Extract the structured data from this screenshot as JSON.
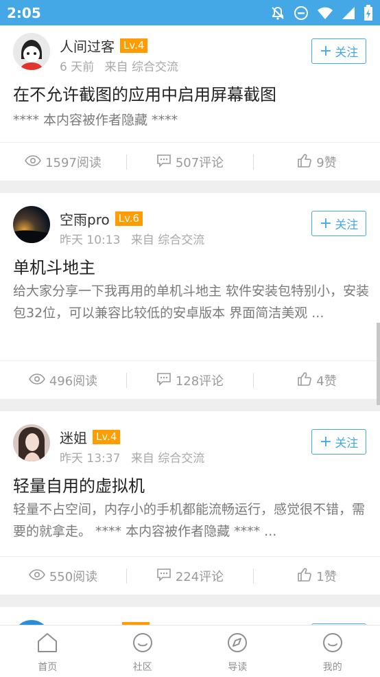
{
  "statusbar": {
    "time": "2:05",
    "icons": [
      "bell-off-icon",
      "do-not-disturb-icon",
      "wifi-icon",
      "signal-icon",
      "battery-charging-icon"
    ]
  },
  "follow_label": "关注",
  "posts": [
    {
      "author": "人间过客",
      "level": "Lv.4",
      "time": "6 天前",
      "source": "来自 综合交流",
      "title": "在不允许截图的应用中启用屏幕截图",
      "body": "**** 本内容被作者隐藏 ****",
      "reads": "1597阅读",
      "comments": "507评论",
      "likes": "9赞"
    },
    {
      "author": "空雨pro",
      "level": "Lv.6",
      "time": "昨天 10:13",
      "source": "来自 综合交流",
      "title": "单机斗地主",
      "body": "给大家分享一下我再用的单机斗地主 软件安装包特别小，安装包32位，可以兼容比较低的安卓版本 界面简洁美观 ...",
      "reads": "496阅读",
      "comments": "128评论",
      "likes": "4赞"
    },
    {
      "author": "迷姐",
      "level": "Lv.4",
      "time": "昨天 13:37",
      "source": "来自 综合交流",
      "title": "轻量自用的虚拟机",
      "body": "轻量不占空间，内存小的手机都能流畅运行，感觉很不错，需要的就拿走。 **** 本内容被作者隐藏 **** ...",
      "reads": "550阅读",
      "comments": "224评论",
      "likes": "1赞"
    }
  ],
  "tabs": [
    {
      "label": "首页",
      "icon": "home-icon"
    },
    {
      "label": "社区",
      "icon": "community-icon"
    },
    {
      "label": "导读",
      "icon": "compass-icon"
    },
    {
      "label": "我的",
      "icon": "profile-icon"
    }
  ],
  "colors": {
    "accent": "#45a8e6",
    "level_badge": "#ff9d00"
  }
}
